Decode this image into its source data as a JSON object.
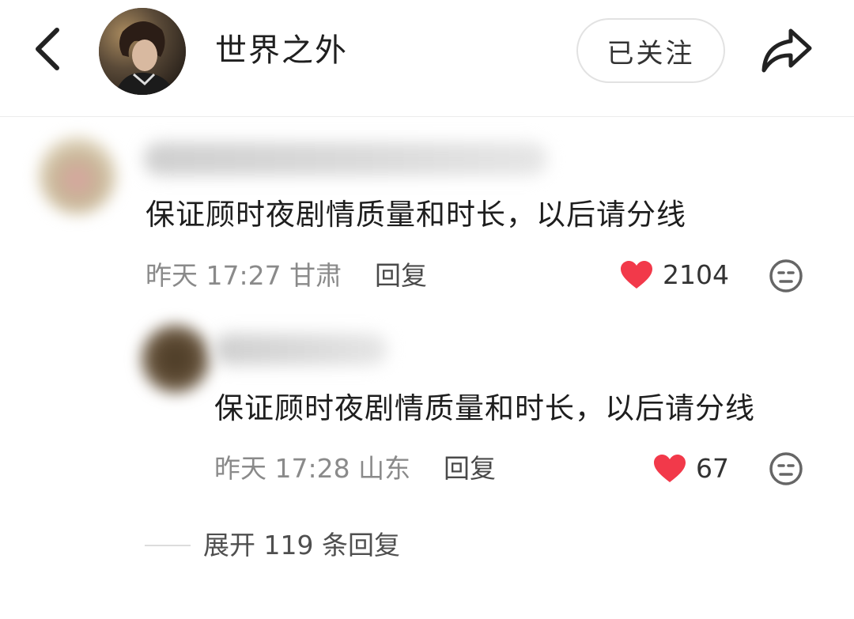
{
  "header": {
    "back_icon": "chevron-left-icon",
    "title": "世界之外",
    "follow_label": "已关注",
    "share_icon": "share-arrow-icon"
  },
  "comments": [
    {
      "text": "保证顾时夜剧情质量和时长，以后请分线",
      "date": "昨天",
      "time": "17:27",
      "location": "甘肃",
      "reply_label": "回复",
      "likes": "2104",
      "like_icon": "heart-icon",
      "emoji_icon": "emoji-icon"
    },
    {
      "text": "保证顾时夜剧情质量和时长，以后请分线",
      "date": "昨天",
      "time": "17:28",
      "location": "山东",
      "reply_label": "回复",
      "likes": "67",
      "like_icon": "heart-icon",
      "emoji_icon": "emoji-icon"
    }
  ],
  "expand": {
    "label": "展开 119 条回复"
  },
  "colors": {
    "heart": "#f2394a",
    "text": "#1e1e1e",
    "meta": "#8a8a8a",
    "border": "#e2e2e2"
  }
}
